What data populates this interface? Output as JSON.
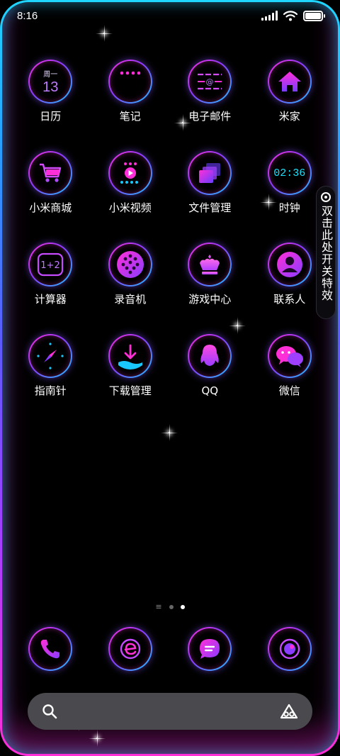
{
  "status_bar": {
    "time": "8:16",
    "signal_icon": "signal-icon",
    "wifi_icon": "wifi-icon",
    "battery_icon": "battery-icon",
    "battery_level": 0.9
  },
  "apps": [
    {
      "label": "日历",
      "icon": "calendar-icon",
      "weekday": "周一",
      "day": "13"
    },
    {
      "label": "笔记",
      "icon": "notes-icon"
    },
    {
      "label": "电子邮件",
      "icon": "email-icon"
    },
    {
      "label": "米家",
      "icon": "home-icon"
    },
    {
      "label": "小米商城",
      "icon": "shopping-cart-icon"
    },
    {
      "label": "小米视频",
      "icon": "video-icon"
    },
    {
      "label": "文件管理",
      "icon": "files-icon"
    },
    {
      "label": "时钟",
      "icon": "clock-icon",
      "clock_time": "02:36"
    },
    {
      "label": "计算器",
      "icon": "calculator-icon",
      "calc_text": "1+2"
    },
    {
      "label": "录音机",
      "icon": "recorder-icon"
    },
    {
      "label": "游戏中心",
      "icon": "game-crown-icon"
    },
    {
      "label": "联系人",
      "icon": "contacts-icon"
    },
    {
      "label": "指南针",
      "icon": "compass-icon"
    },
    {
      "label": "下载管理",
      "icon": "download-icon"
    },
    {
      "label": "QQ",
      "icon": "qq-penguin-icon"
    },
    {
      "label": "微信",
      "icon": "wechat-icon"
    }
  ],
  "side_tab": {
    "text": "双击此处开关特效",
    "icon": "record-dot-icon"
  },
  "pager": {
    "pages": 3,
    "active_index": 2,
    "first_icon": "menu-lines-icon"
  },
  "dock": [
    {
      "icon": "phone-icon"
    },
    {
      "icon": "browser-icon"
    },
    {
      "icon": "messages-icon"
    },
    {
      "icon": "camera-icon"
    }
  ],
  "search_bar": {
    "search_icon": "search-icon",
    "assistant_icon": "assistant-icon"
  },
  "colors": {
    "accent_pink": "#ff2fd8",
    "accent_purple": "#8a3cff",
    "accent_cyan": "#19c8ff",
    "search_bg": "#4a4a4e"
  }
}
